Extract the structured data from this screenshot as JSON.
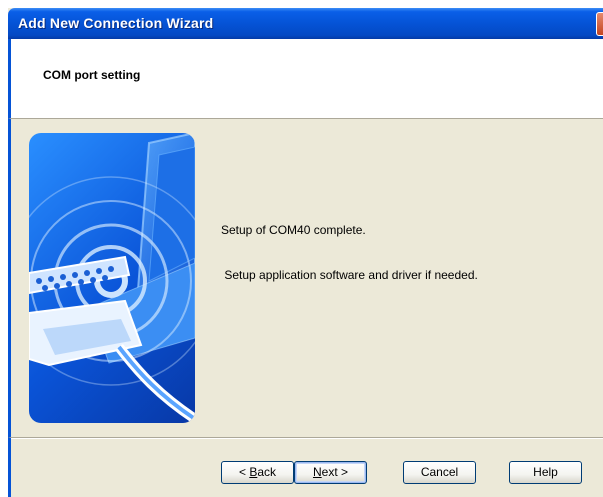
{
  "window": {
    "title": "Add New Connection Wizard",
    "close_glyph": "✕"
  },
  "header": {
    "title": "COM port setting"
  },
  "content": {
    "message_line1": "Setup of COM40 complete.",
    "message_line2": " Setup application software and driver if needed.",
    "illustration_icon": "connection-waves-illustration"
  },
  "footer": {
    "back_prefix": "< ",
    "back_accel": "B",
    "back_rest": "ack",
    "next_accel": "N",
    "next_rest": "ext >",
    "cancel_label": "Cancel",
    "help_label": "Help"
  },
  "colors": {
    "titlebar": "#0553d6",
    "dialog_bg": "#ece9d8",
    "accent": "#0553d6"
  }
}
